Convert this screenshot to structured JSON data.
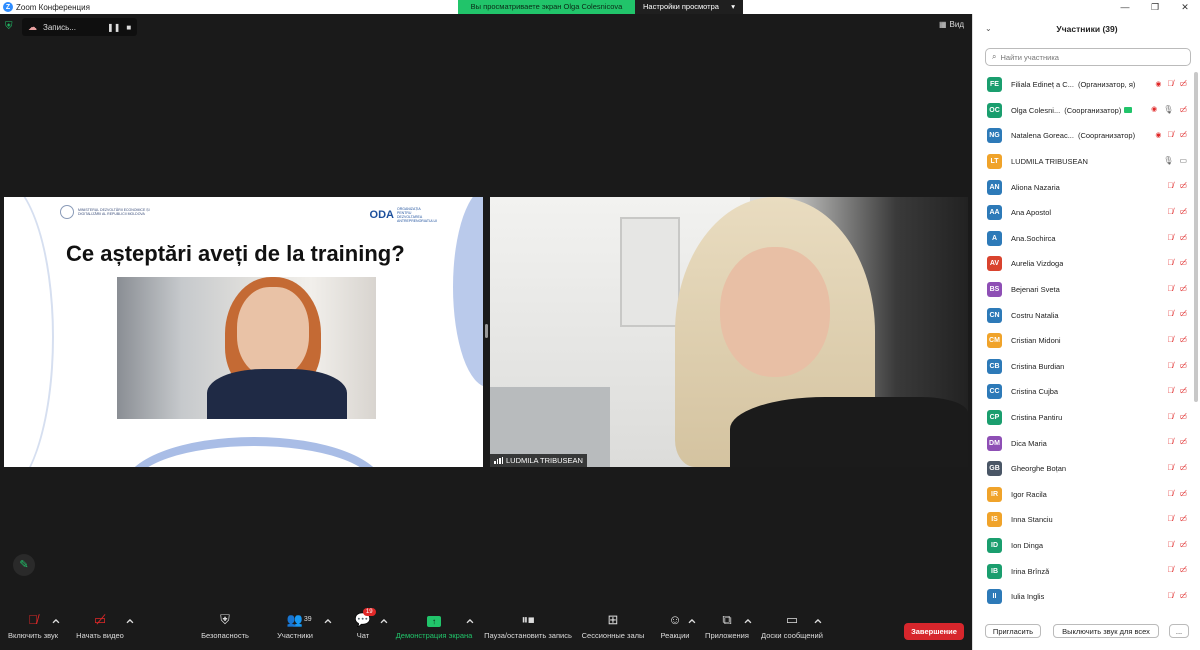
{
  "window": {
    "title": "Zoom Конференция",
    "share_banner": "Вы просматриваете экран Olga Colesnicova",
    "view_settings": "Настройки просмотра",
    "view_settings_caret": "▾"
  },
  "meeting": {
    "recording_label": "Запись...",
    "view_label": "Вид"
  },
  "slide": {
    "ministry_text": "MINISTERUL DEZVOLTĂRII ECONOMICE ȘI DIGITALIZĂRII AL REPUBLICII MOLDOVA",
    "logo": "ODA",
    "logo_sub": "ORGANIZAȚIA PENTRU DEZVOLTAREA ANTREPRENORIATULUI",
    "title": "Ce așteptări aveți de la training?"
  },
  "camera": {
    "name": "LUDMILA TRIBUSEAN"
  },
  "toolbar": {
    "unmute": "Включить звук",
    "start_video": "Начать видео",
    "security": "Безопасность",
    "participants": "Участники",
    "participants_count": "39",
    "chat": "Чат",
    "chat_badge": "19",
    "share": "Демонстрация экрана",
    "pause_recording": "Пауза/остановить запись",
    "breakout": "Сессионные залы",
    "reactions": "Реакции",
    "apps": "Приложения",
    "whiteboards": "Доски сообщений",
    "end": "Завершение"
  },
  "panel": {
    "title": "Участники (39)",
    "search_placeholder": "Найти участника",
    "invite": "Пригласить",
    "mute_all": "Выключить звук для всех",
    "more": "...",
    "participants": [
      {
        "initials": "FE",
        "name": "Filiala Edineț a C...",
        "role": "(Организатор, я)",
        "color": "#1a9e6e",
        "mic": "off",
        "video": "off",
        "eye": true
      },
      {
        "initials": "OC",
        "name": "Olga Colesni...",
        "role": "(Соорганизатор)",
        "color": "#1a9e6e",
        "mic": "on",
        "video": "off",
        "eye": true,
        "sharing": true
      },
      {
        "initials": "NG",
        "name": "Natalena Goreac...",
        "role": "(Соорганизатор)",
        "color": "#2d7ab8",
        "mic": "off",
        "video": "off",
        "eye": true
      },
      {
        "initials": "LT",
        "name": "LUDMILA TRIBUSEAN",
        "role": "",
        "color": "#f0a32a",
        "mic": "on",
        "video": "on"
      },
      {
        "initials": "AN",
        "name": "Aliona Nazaria",
        "role": "",
        "color": "#2d7ab8",
        "mic": "off",
        "video": "off"
      },
      {
        "initials": "AA",
        "name": "Ana Apostol",
        "role": "",
        "color": "#2d7ab8",
        "mic": "off",
        "video": "off"
      },
      {
        "initials": "A",
        "name": "Ana.Sochirca",
        "role": "",
        "color": "#2d7ab8",
        "mic": "off",
        "video": "off"
      },
      {
        "initials": "AV",
        "name": "Aurelia Vizdoga",
        "role": "",
        "color": "#d9432e",
        "mic": "off",
        "video": "off"
      },
      {
        "initials": "BS",
        "name": "Bejenari Sveta",
        "role": "",
        "color": "#8e4fb5",
        "mic": "off",
        "video": "off"
      },
      {
        "initials": "CN",
        "name": "Costru Natalia",
        "role": "",
        "color": "#2d7ab8",
        "mic": "off",
        "video": "off"
      },
      {
        "initials": "CM",
        "name": "Cristian Midoni",
        "role": "",
        "color": "#f0a32a",
        "mic": "off",
        "video": "off"
      },
      {
        "initials": "CB",
        "name": "Cristina Burdian",
        "role": "",
        "color": "#2d7ab8",
        "mic": "off",
        "video": "off"
      },
      {
        "initials": "CC",
        "name": "Cristina Cujba",
        "role": "",
        "color": "#2d7ab8",
        "mic": "off",
        "video": "off"
      },
      {
        "initials": "CP",
        "name": "Cristina Pantiru",
        "role": "",
        "color": "#1a9e6e",
        "mic": "off",
        "video": "off"
      },
      {
        "initials": "DM",
        "name": "Dica Maria",
        "role": "",
        "color": "#8e4fb5",
        "mic": "off",
        "video": "off"
      },
      {
        "initials": "GB",
        "name": "Gheorghe Boțan",
        "role": "",
        "color": "#4a5666",
        "mic": "off",
        "video": "off"
      },
      {
        "initials": "IR",
        "name": "Igor Racila",
        "role": "",
        "color": "#f0a32a",
        "mic": "off",
        "video": "off"
      },
      {
        "initials": "IS",
        "name": "Inna Stanciu",
        "role": "",
        "color": "#f0a32a",
        "mic": "off",
        "video": "off"
      },
      {
        "initials": "ID",
        "name": "Ion Dinga",
        "role": "",
        "color": "#1a9e6e",
        "mic": "off",
        "video": "off"
      },
      {
        "initials": "IB",
        "name": "Irina Brînză",
        "role": "",
        "color": "#1a9e6e",
        "mic": "off",
        "video": "off"
      },
      {
        "initials": "II",
        "name": "Iulia Inglis",
        "role": "",
        "color": "#2d7ab8",
        "mic": "off",
        "video": "off"
      }
    ]
  },
  "colors": {
    "accent_green": "#21c46a",
    "end_red": "#d7262c",
    "muted_red": "#e02828"
  }
}
